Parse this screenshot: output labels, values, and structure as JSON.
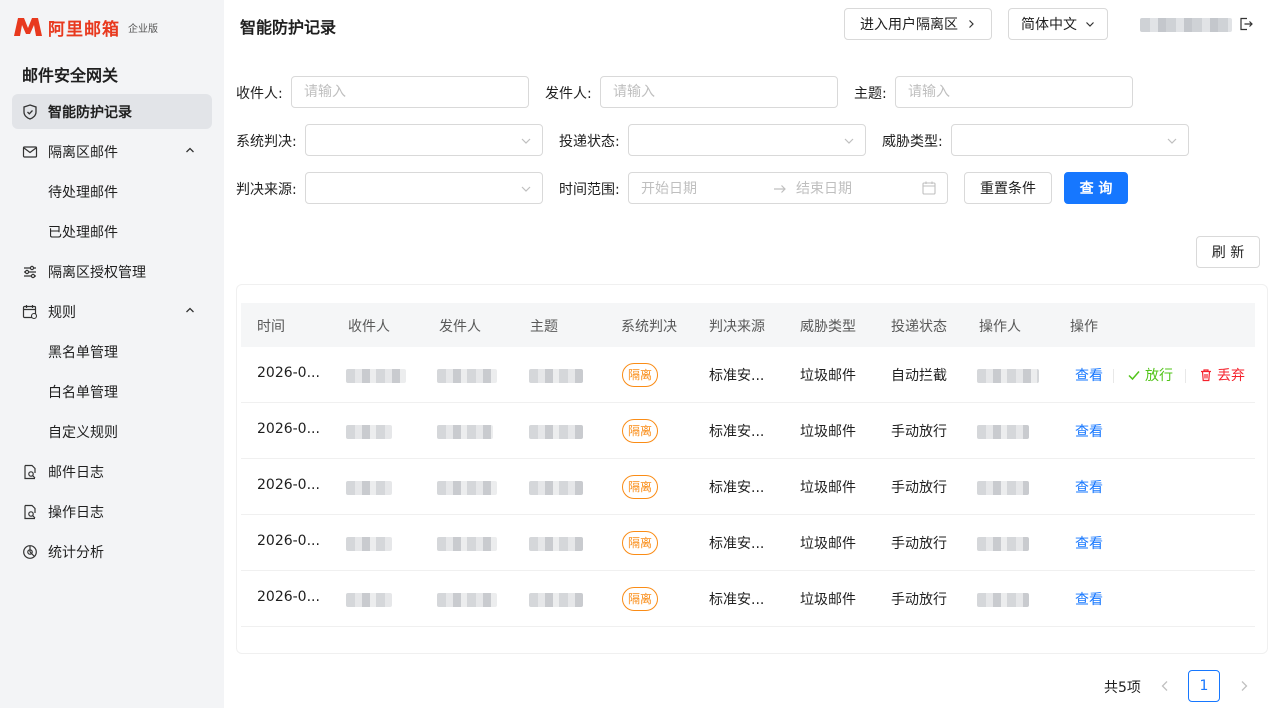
{
  "brand": {
    "logo_text": "阿里邮箱",
    "edition": "企业版",
    "accent": "#e8391e"
  },
  "sidebar": {
    "product_title": "邮件安全网关",
    "items": [
      {
        "label": "智能防护记录",
        "icon": "shield-icon",
        "active": true
      },
      {
        "label": "隔离区邮件",
        "icon": "mail-icon",
        "expanded": true
      },
      {
        "label": "待处理邮件",
        "sub": true
      },
      {
        "label": "已处理邮件",
        "sub": true
      },
      {
        "label": "隔离区授权管理",
        "icon": "sliders-icon"
      },
      {
        "label": "规则",
        "icon": "calendar-rule-icon",
        "expanded": true
      },
      {
        "label": "黑名单管理",
        "sub": true
      },
      {
        "label": "白名单管理",
        "sub": true
      },
      {
        "label": "自定义规则",
        "sub": true
      },
      {
        "label": "邮件日志",
        "icon": "log-search-icon"
      },
      {
        "label": "操作日志",
        "icon": "operation-log-icon"
      },
      {
        "label": "统计分析",
        "icon": "pie-chart-icon"
      }
    ]
  },
  "header": {
    "title": "智能防护记录",
    "user_quarantine_btn": "进入用户隔离区",
    "language": "简体中文"
  },
  "filters": {
    "recipient_label": "收件人:",
    "recipient_placeholder": "请输入",
    "sender_label": "发件人:",
    "sender_placeholder": "请输入",
    "subject_label": "主题:",
    "subject_placeholder": "请输入",
    "verdict_label": "系统判决:",
    "delivery_label": "投递状态:",
    "threat_label": "威胁类型:",
    "source_label": "判决来源:",
    "time_label": "时间范围:",
    "start_placeholder": "开始日期",
    "end_placeholder": "结束日期",
    "reset_btn": "重置条件",
    "search_btn": "查 询"
  },
  "refresh_btn": "刷 新",
  "table": {
    "columns": [
      "时间",
      "收件人",
      "发件人",
      "主题",
      "系统判决",
      "判决来源",
      "威胁类型",
      "投递状态",
      "操作人",
      "操作"
    ],
    "rows": [
      {
        "time": "2026-0...",
        "verdict": "隔离",
        "source": "标准安...",
        "threat": "垃圾邮件",
        "delivery": "自动拦截",
        "actions": [
          "查看",
          "放行",
          "丢弃"
        ]
      },
      {
        "time": "2026-0...",
        "verdict": "隔离",
        "source": "标准安...",
        "threat": "垃圾邮件",
        "delivery": "手动放行",
        "actions": [
          "查看"
        ]
      },
      {
        "time": "2026-0...",
        "verdict": "隔离",
        "source": "标准安...",
        "threat": "垃圾邮件",
        "delivery": "手动放行",
        "actions": [
          "查看"
        ]
      },
      {
        "time": "2026-0...",
        "verdict": "隔离",
        "source": "标准安...",
        "threat": "垃圾邮件",
        "delivery": "手动放行",
        "actions": [
          "查看"
        ]
      },
      {
        "time": "2026-0...",
        "verdict": "隔离",
        "source": "标准安...",
        "threat": "垃圾邮件",
        "delivery": "手动放行",
        "actions": [
          "查看"
        ]
      }
    ]
  },
  "pagination": {
    "total": "共5项",
    "current": "1"
  },
  "colors": {
    "primary": "#1677ff",
    "tag_orange": "#fa8c16",
    "release_green": "#52c41a",
    "discard_red": "#f5222d"
  }
}
